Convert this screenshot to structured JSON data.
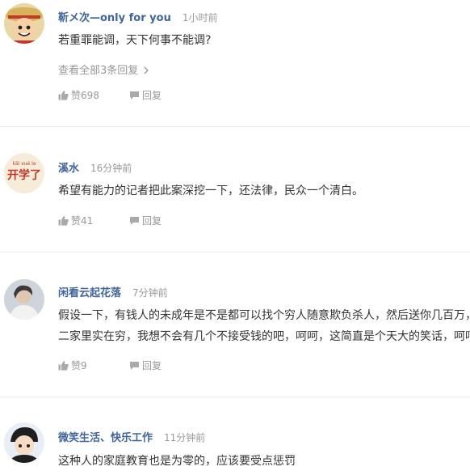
{
  "comments": [
    {
      "username": "靳メ次—only for you",
      "time": "1小时前",
      "lines": [
        "若重罪能调，天下何事不能调?"
      ],
      "view_replies": "查看全部3条回复",
      "like_label": "赞698",
      "reply_label": "回复",
      "avatar": "one-piece-luffy-avatar"
    },
    {
      "username": "溪水",
      "time": "16分钟前",
      "lines": [
        "希望有能力的记者把此案深挖一下，还法律，民众一个清白。"
      ],
      "like_label": "赞41",
      "reply_label": "回复",
      "avatar": "kai-xue-le-avatar",
      "avatar_text": {
        "pinyin": "kāi xué le",
        "hanzi": "开学了"
      }
    },
    {
      "username": "闲看云起花落",
      "time": "7分钟前",
      "lines": [
        "假设一下，有钱人的未成年是不是都可以找个穷人随意欺负杀人，然后送你几百万，",
        "二家里实在穷，我想不会有几个不接受钱的吧，呵呵，这简直是个天大的笑话，呵呵"
      ],
      "like_label": "赞9",
      "reply_label": "回复",
      "avatar": "portrait-avatar"
    },
    {
      "username": "微笑生活、快乐工作",
      "time": "11分钟前",
      "lines": [
        "这种人的家庭教育也是为零的，应该要受点惩罚"
      ],
      "avatar": "cartoon-boy-avatar"
    }
  ],
  "colors": {
    "username": "#406599",
    "meta": "#999999",
    "text": "#333333",
    "divider": "#ececec"
  }
}
